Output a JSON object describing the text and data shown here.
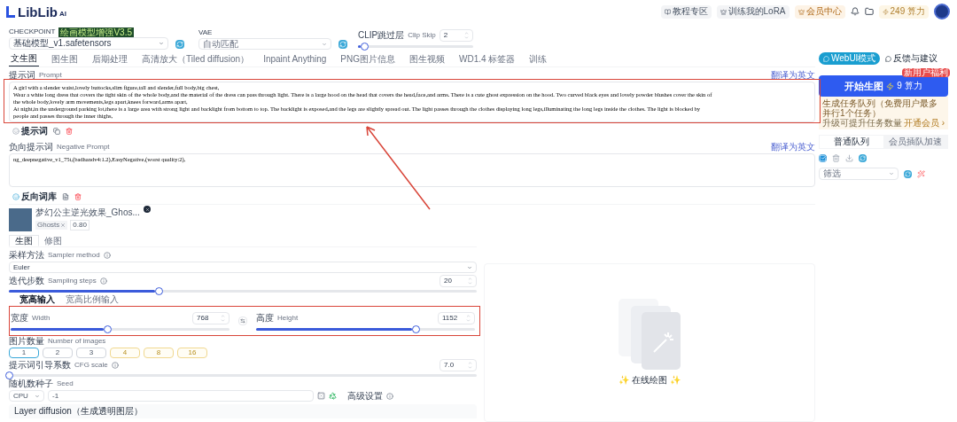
{
  "logo": {
    "text": "LibLib",
    "sup": "AI"
  },
  "header": {
    "links": [
      "教程专区",
      "训练我的LoRA",
      "会员中心"
    ],
    "credits": "249 算力"
  },
  "model": {
    "checkpoint_label": "CHECKPOINT",
    "checkpoint_badge": "绘画模型增强V3.5",
    "checkpoint_value": "基础模型_v1.safetensors",
    "vae_label": "VAE",
    "vae_value": "自动匹配"
  },
  "clip": {
    "label": "CLIP跳过层",
    "label_en": "Clip Skip",
    "value": "2",
    "level": 0.05
  },
  "tabs": [
    {
      "label": "文生图",
      "selected": true
    },
    {
      "label": "图生图",
      "selected": false
    },
    {
      "label": "后期处理",
      "selected": false
    },
    {
      "label": "高清放大（Tiled diffusion）",
      "selected": false
    },
    {
      "label": "Inpaint Anything",
      "selected": false
    },
    {
      "label": "PNG图片信息",
      "selected": false
    },
    {
      "label": "图生视频",
      "selected": false
    },
    {
      "label": "WD1.4 标签器",
      "selected": false
    },
    {
      "label": "训练",
      "selected": false
    }
  ],
  "prompt": {
    "label": "提示词",
    "label_en": "Prompt",
    "translate": "翻译为英文",
    "button": "提示词",
    "lines": [
      "A girl with a slender waist,lovely buttocks,slim figure,tall and slender,full body,big chest,",
      "Wear a white long dress that covers the tight skin of the whole body,and the material of the dress can pass through light. There is a large hood on the head that covers the head,face,and arms. There is a cute ghost expression on the hood. Two curved black eyes and lovely powder blushes cover the skin of",
      "the whole body,lovely arm movements,legs apart,knees forward,arms apart,",
      "At night,in the underground parking lot,there is a large area with strong light and backlight from bottom to top. The backlight is exposed,and the legs are slightly spread out. The light passes through the clothes displaying long legs,illuminating the long legs inside the clothes. The light is blocked by",
      "people and passes through the inner thighs,"
    ]
  },
  "negative": {
    "label": "负向提示词",
    "label_en": "Negative Prompt",
    "translate": "翻译为英文",
    "button": "反向词库",
    "lines": [
      "ng_deepnegative_v1_75t,(badhandv4:1.2),EasyNegative,(worst quality:2),"
    ]
  },
  "lora": {
    "name": "梦幻公主逆光效果_Ghos...",
    "weight": "0.80",
    "tag": "Ghosts"
  },
  "sub_tabs": [
    {
      "label": "生图",
      "selected": true
    },
    {
      "label": "修图",
      "selected": false
    }
  ],
  "sampler": {
    "label": "采样方法",
    "label_en": "Sampler method",
    "value": "Euler"
  },
  "steps": {
    "label": "迭代步数",
    "label_en": "Sampling steps",
    "value": "20",
    "level": 0.32
  },
  "size_modes": [
    {
      "label": "宽高输入",
      "selected": true
    },
    {
      "label": "宽高比例输入",
      "selected": false
    }
  ],
  "width": {
    "label": "宽度",
    "label_en": "Width",
    "value": "768",
    "level": 0.44
  },
  "height": {
    "label": "高度",
    "label_en": "Height",
    "value": "1152",
    "level": 0.73
  },
  "image_count": {
    "label": "图片数量",
    "label_en": "Number of images",
    "options": [
      {
        "label": "1",
        "selected": true,
        "vip": false
      },
      {
        "label": "2",
        "selected": false,
        "vip": false
      },
      {
        "label": "3",
        "selected": false,
        "vip": false
      },
      {
        "label": "4",
        "selected": false,
        "vip": true
      },
      {
        "label": "8",
        "selected": false,
        "vip": true
      },
      {
        "label": "16",
        "selected": false,
        "vip": true
      }
    ]
  },
  "cfg": {
    "label": "提示词引导系数",
    "label_en": "CFG scale",
    "value": "7.0",
    "level": 0.0
  },
  "seed": {
    "label": "随机数种子",
    "label_en": "Seed",
    "device": "CPU",
    "value": "-1",
    "option": "高级设置"
  },
  "layer_diffusion": {
    "title": "Layer diffusion（生成透明图层）"
  },
  "right": {
    "mode_button": "WebUI模式",
    "feedback": "反馈与建议",
    "generate": "开始生图",
    "cost": "9",
    "cost_unit": "算力",
    "badge": "新用户福利",
    "queue_title": "生成任务队列（免费用户最多并行1个任务）",
    "queue_note": "升级可提升任务数量",
    "queue_link": "开通会员 ›",
    "queue_tabs": [
      {
        "label": "普通队列",
        "selected": true
      },
      {
        "label": "会员插队加速",
        "selected": false
      }
    ],
    "filter_placeholder": "筛选"
  },
  "gallery": {
    "label": "✨ 在线绘图 ✨"
  }
}
